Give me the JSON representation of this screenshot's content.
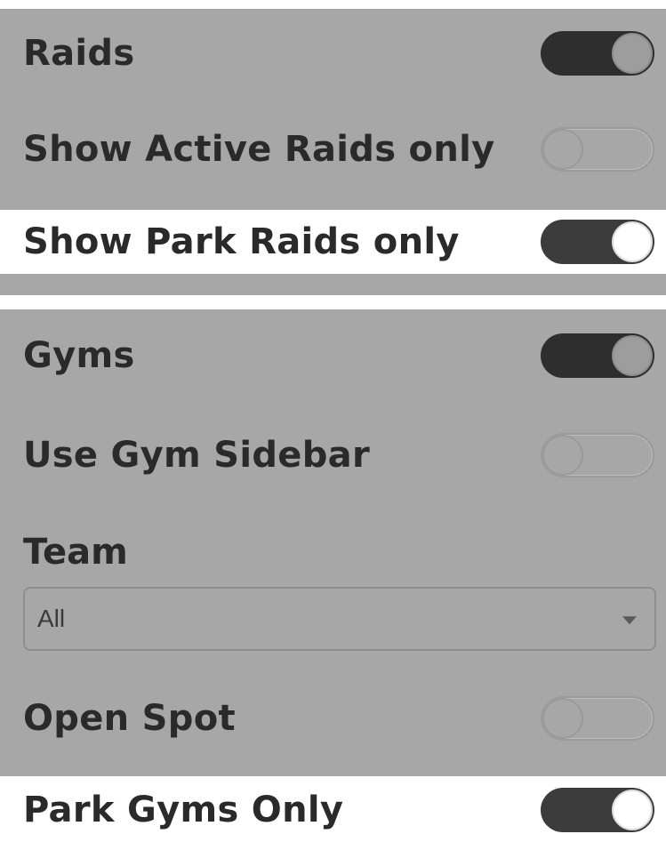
{
  "raids": {
    "label": "Raids",
    "enabled": true
  },
  "show_active_raids_only": {
    "label": "Show Active Raids only",
    "enabled": false
  },
  "show_park_raids_only": {
    "label": "Show Park Raids only",
    "enabled": true
  },
  "gyms": {
    "label": "Gyms",
    "enabled": true
  },
  "use_gym_sidebar": {
    "label": "Use Gym Sidebar",
    "enabled": false
  },
  "team": {
    "label": "Team",
    "selected": "All"
  },
  "open_spot": {
    "label": "Open Spot",
    "enabled": false
  },
  "park_gyms_only": {
    "label": "Park Gyms Only",
    "enabled": true
  },
  "colors": {
    "panel_gray": "#a7a7a7",
    "highlight_white": "#ffffff",
    "toggle_on": "#3c3c3c",
    "text": "#2a2a2a"
  },
  "icons": {
    "select_caret": "caret-down-icon"
  }
}
